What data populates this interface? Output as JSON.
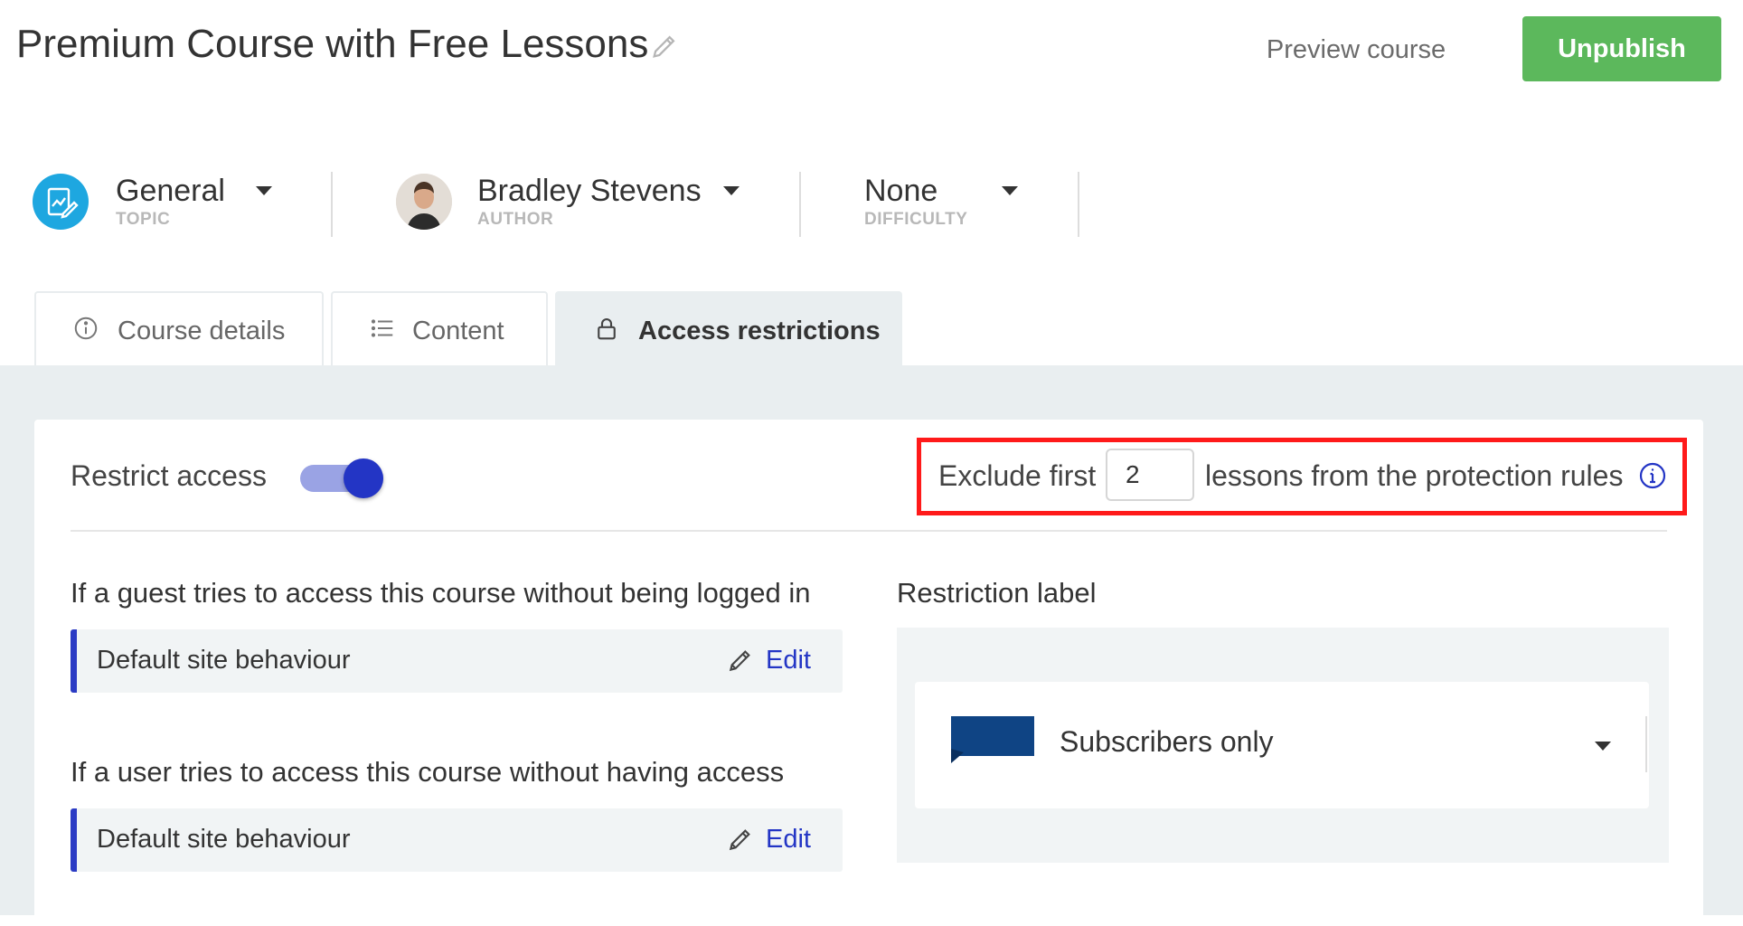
{
  "header": {
    "title": "Premium Course with Free Lessons",
    "preview_label": "Preview course",
    "unpublish_label": "Unpublish"
  },
  "meta": {
    "topic": {
      "value": "General",
      "label": "TOPIC"
    },
    "author": {
      "value": "Bradley Stevens",
      "label": "AUTHOR"
    },
    "difficulty": {
      "value": "None",
      "label": "DIFFICULTY"
    }
  },
  "tabs": [
    {
      "label": "Course details",
      "icon": "info-circle-icon"
    },
    {
      "label": "Content",
      "icon": "list-icon"
    },
    {
      "label": "Access restrictions",
      "icon": "lock-icon",
      "active": true
    }
  ],
  "access": {
    "restrict_label": "Restrict access",
    "restrict_enabled": true,
    "exclude_prefix": "Exclude first",
    "exclude_value": "2",
    "exclude_suffix": "lessons from the protection rules",
    "guest_heading": "If a guest tries to access this course without being logged in",
    "guest_behaviour": "Default site behaviour",
    "user_heading": "If a user tries to access this course without having access",
    "user_behaviour": "Default site behaviour",
    "edit_label": "Edit",
    "restriction_label_heading": "Restriction label",
    "restriction_value": "Subscribers only"
  },
  "colors": {
    "accent": "#2335c5",
    "publish_green": "#5cb85c",
    "highlight_red": "#ff1a1a",
    "topic_blue": "#1ea7e0",
    "flag_blue": "#0f4484"
  }
}
